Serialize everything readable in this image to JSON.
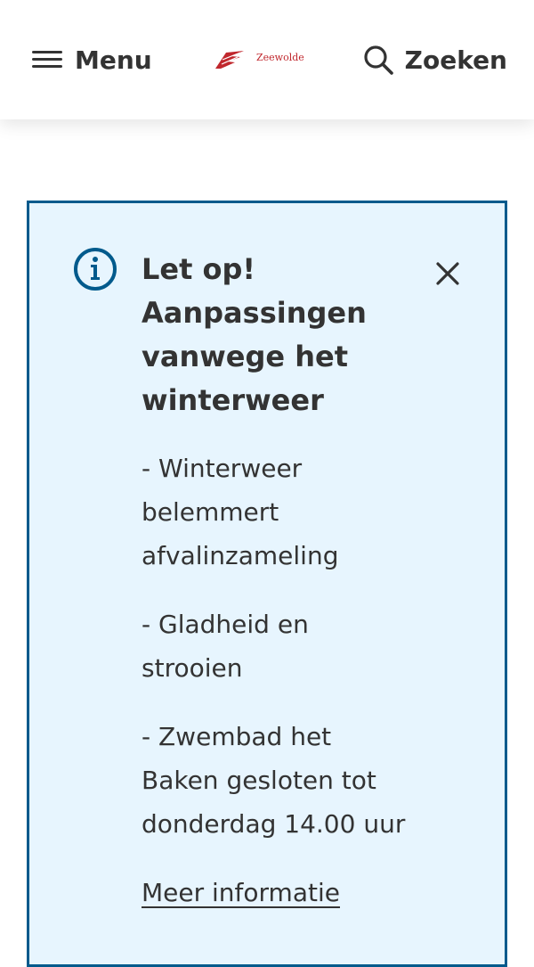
{
  "header": {
    "menu_label": "Menu",
    "logo_text": "Zeewolde",
    "search_label": "Zoeken"
  },
  "alert": {
    "title": "Let op! Aanpassingen vanwege het winterweer",
    "items": [
      "- Winterweer belemmert afvalinzameling",
      "- Gladheid en strooien",
      "- Zwembad het Baken gesloten tot donderdag 14.00 uur"
    ],
    "link_label": "Meer informatie",
    "colors": {
      "background": "#e7f5fe",
      "border": "#005a8c",
      "icon": "#005a8c"
    }
  },
  "icons": [
    "menu-icon",
    "zeewolde-logo-icon",
    "search-icon",
    "info-icon",
    "close-icon"
  ]
}
